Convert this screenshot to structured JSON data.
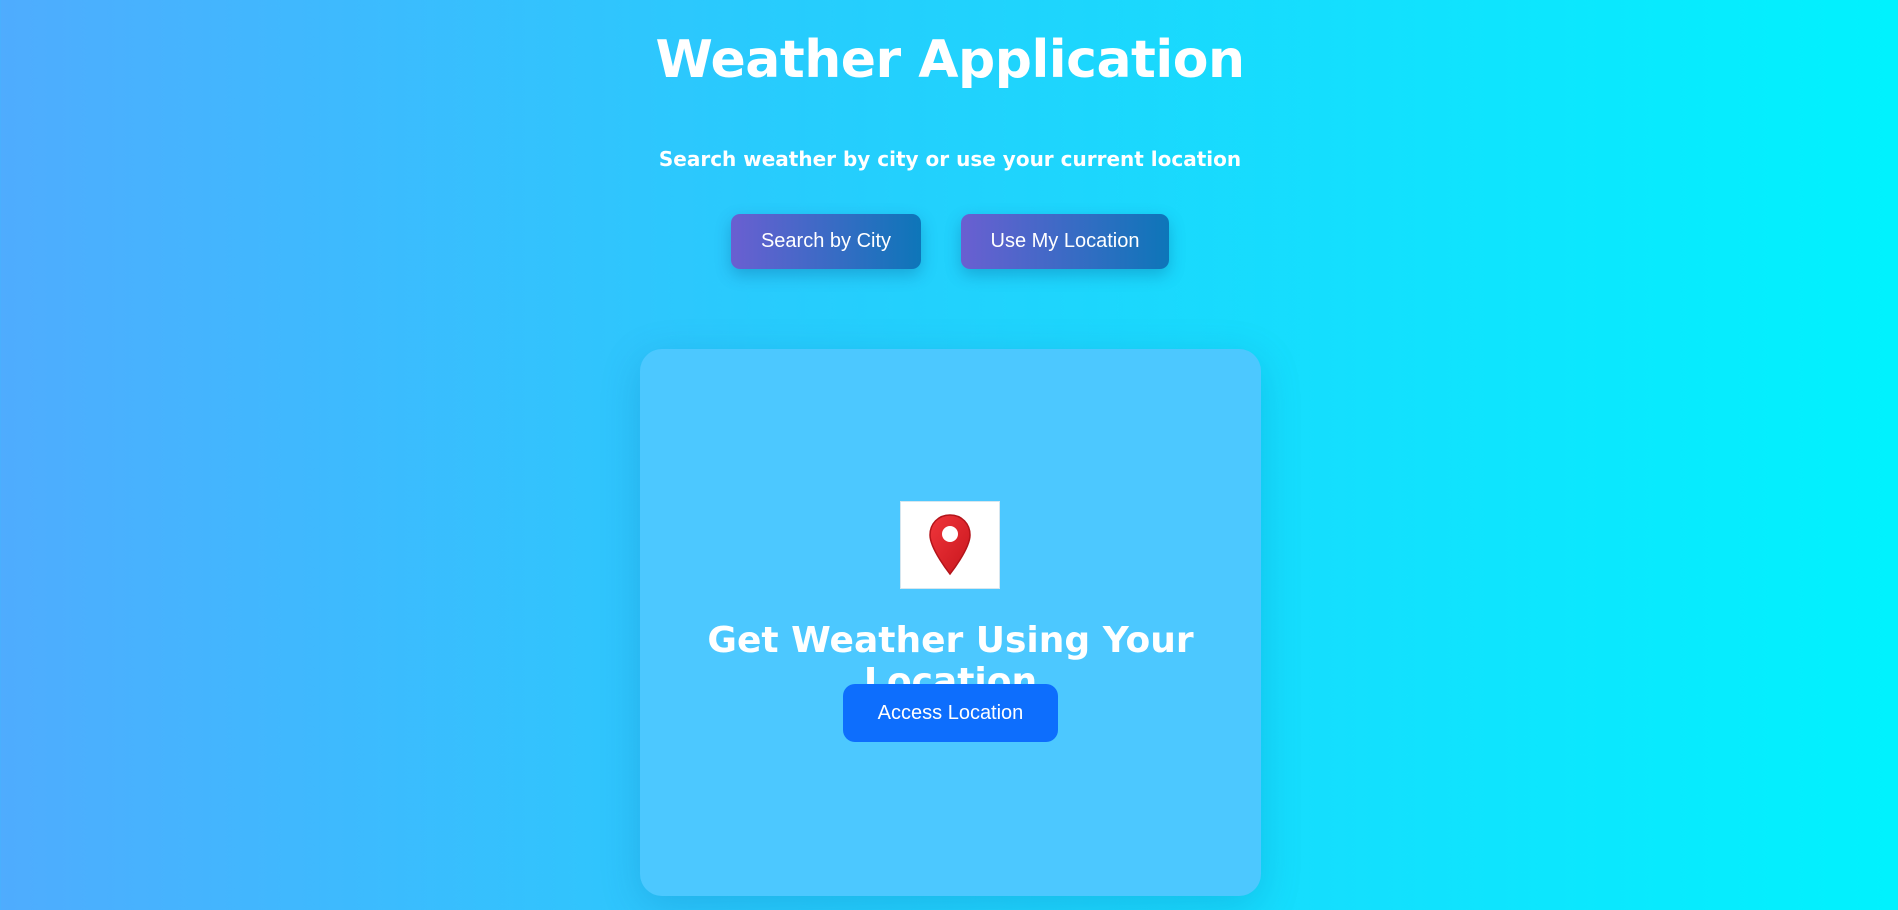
{
  "header": {
    "title": "Weather Application",
    "subtitle": "Search weather by city or use your current location"
  },
  "mode_buttons": {
    "search_by_city": "Search by City",
    "use_my_location": "Use My Location"
  },
  "location_card": {
    "icon": "location-pin-icon",
    "heading": "Get Weather Using Your Location",
    "access_button": "Access Location"
  },
  "colors": {
    "background_start": "#4facfe",
    "background_end": "#00f2fe",
    "card": "#4cc8ff",
    "button_gradient_start": "#6a5fd1",
    "button_gradient_end": "#0d76b9",
    "access_button": "#0d6efd",
    "pin": "#e3242b"
  }
}
